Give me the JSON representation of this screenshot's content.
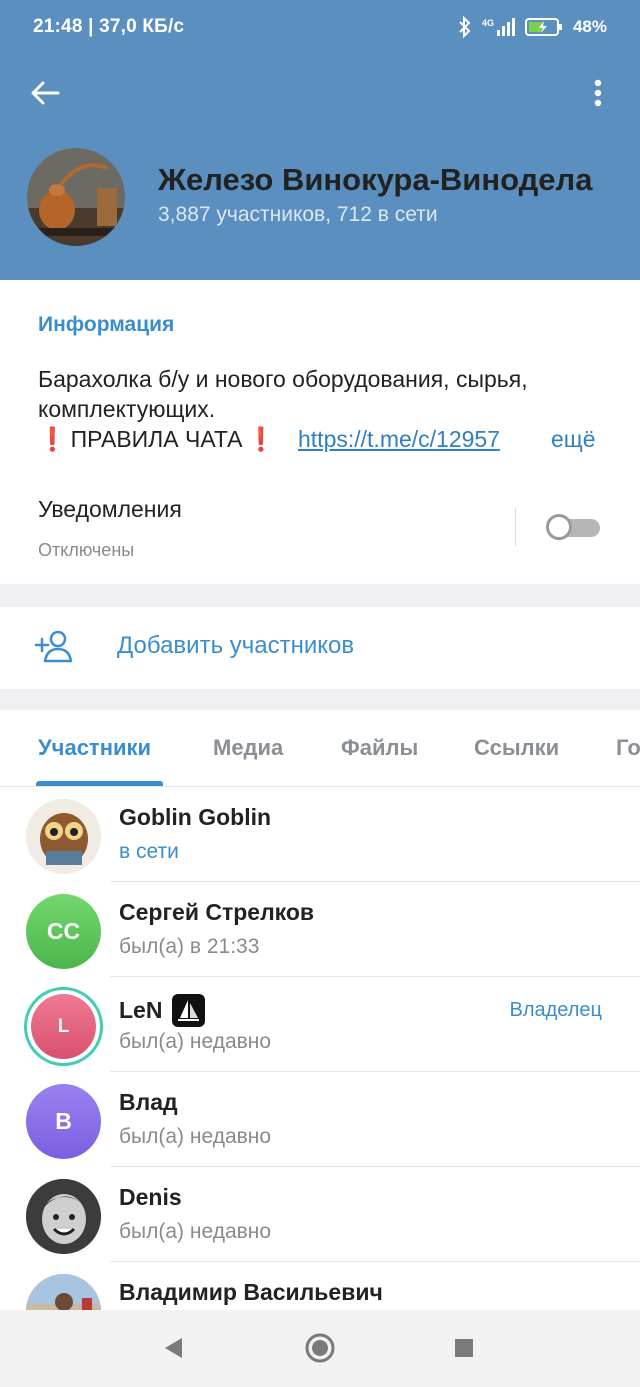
{
  "status_bar": {
    "time": "21:48 | 37,0 КБ/с",
    "network": "4G",
    "battery": "48%"
  },
  "header": {
    "title": "Железо Винокура-Винодела",
    "subtitle": "3,887 участников, 712 в сети"
  },
  "info": {
    "heading": "Информация",
    "description": "Барахолка б/у и нового оборудования, сырья, комплектующих.",
    "rules_label": "ПРАВИЛА ЧАТА",
    "link": "https://t.me/c/12957",
    "more": "ещё",
    "notifications_label": "Уведомления",
    "notifications_state": "Отключены"
  },
  "actions": {
    "add_members": "Добавить участников"
  },
  "tabs": [
    {
      "label": "Участники",
      "active": true
    },
    {
      "label": "Медиа",
      "active": false
    },
    {
      "label": "Файлы",
      "active": false
    },
    {
      "label": "Ссылки",
      "active": false
    },
    {
      "label": "Го",
      "active": false
    }
  ],
  "members": [
    {
      "name": "Goblin Goblin",
      "status": "в сети",
      "online": true,
      "avatar": "photo-owl"
    },
    {
      "name": "Сергей Стрелков",
      "status": "был(а) в 21:33",
      "initials": "СС",
      "color": "#5cc45a"
    },
    {
      "name": "LeN",
      "status": "был(а) недавно",
      "initials": "L",
      "color": "#e0607a",
      "role": "Владелец"
    },
    {
      "name": "Влад",
      "status": "был(а) недавно",
      "initials": "В",
      "color": "#8a6de8"
    },
    {
      "name": "Denis",
      "status": "был(а) недавно",
      "avatar": "photo-child"
    },
    {
      "name": "Владимир Васильевич",
      "status": "",
      "avatar": "photo-man"
    }
  ],
  "colors": {
    "header_bg": "#5b8fbf",
    "accent": "#3a8ed0"
  }
}
